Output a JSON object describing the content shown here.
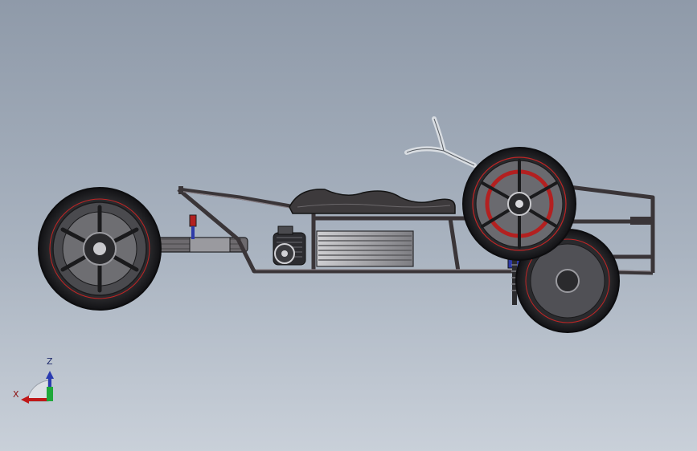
{
  "view": {
    "background_top": "#8f9aa9",
    "background_bottom": "#c9d0d9"
  },
  "triad": {
    "z_label": "Z",
    "x_label": "X",
    "z_color": "#2a3bb0",
    "x_color": "#c01818",
    "y_color": "#1fa83a"
  },
  "model": {
    "frame_color": "#3a3538",
    "tire_color": "#2b2b2e",
    "rim_stripe_color": "#c02525",
    "seat_color": "#3d3a3c",
    "shock_color": "#2e3aa8",
    "handlebar_color": "#d9dde2"
  }
}
